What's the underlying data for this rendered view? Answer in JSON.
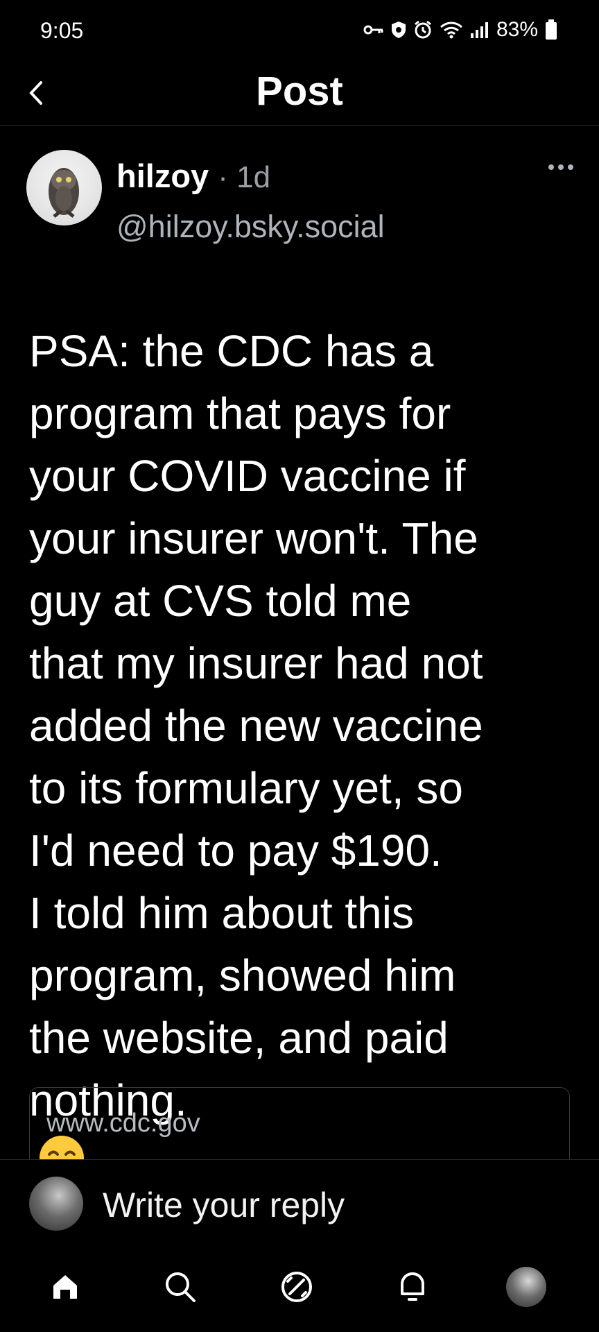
{
  "status_bar": {
    "time": "9:05",
    "battery": "83%"
  },
  "header": {
    "title": "Post",
    "back_icon": "chevron-left-icon"
  },
  "post": {
    "author_name": "hilzoy",
    "time_ago": "· 1d",
    "handle": "@hilzoy.bsky.social",
    "text": "PSA: the CDC has a\nprogram that pays for\nyour COVID vaccine if\nyour insurer won't. The\nguy at CVS told me\nthat my insurer had not\nadded the new vaccine\nto its formulary yet, so\nI'd need to pay $190.\nI told him about this\nprogram, showed him\nthe website, and paid\nnothing.",
    "emoji": "hugging-face-emoji",
    "link_card": {
      "domain": "www.cdc.gov"
    }
  },
  "reply_bar": {
    "placeholder": "Write your reply"
  },
  "bottom_nav": {
    "items": [
      "home-icon",
      "search-icon",
      "feeds-icon",
      "notifications-icon",
      "profile-avatar"
    ]
  },
  "colors": {
    "background": "#000000",
    "text": "#ffffff",
    "muted": "#9aa0a6",
    "divider": "#2a2a2a"
  }
}
